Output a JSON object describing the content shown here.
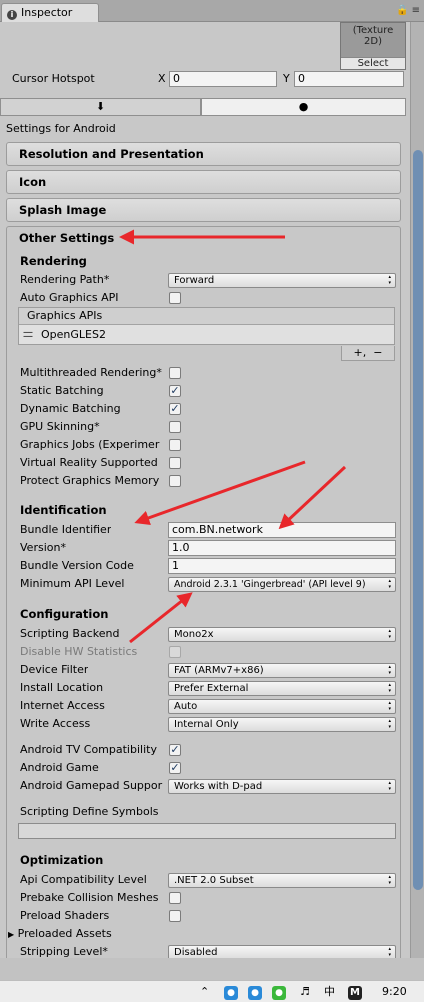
{
  "window": {
    "tab_title": "Inspector",
    "tab_icon": "info-icon"
  },
  "texture_preview": {
    "caption_line1": "(Texture",
    "caption_line2": "2D)",
    "select_label": "Select"
  },
  "cursor_hotspot": {
    "label": "Cursor Hotspot",
    "x_label": "X",
    "x_value": "0",
    "y_label": "Y",
    "y_value": "0"
  },
  "platform_tabs": [
    {
      "icon": "download-icon"
    },
    {
      "icon": "android-icon"
    }
  ],
  "settings_for": "Settings for Android",
  "sections": {
    "resolution": "Resolution and Presentation",
    "icon": "Icon",
    "splash": "Splash Image",
    "other": "Other Settings"
  },
  "rendering": {
    "heading": "Rendering",
    "rendering_path": {
      "label": "Rendering Path*",
      "value": "Forward"
    },
    "auto_graphics": {
      "label": "Auto Graphics API",
      "checked": false
    },
    "graphics_apis": {
      "header": "Graphics APIs",
      "items": [
        "OpenGLES2"
      ],
      "add": "+,",
      "remove": "−"
    },
    "multithreaded": {
      "label": "Multithreaded Rendering*",
      "checked": false
    },
    "static_batching": {
      "label": "Static Batching",
      "checked": true
    },
    "dynamic_batching": {
      "label": "Dynamic Batching",
      "checked": true
    },
    "gpu_skinning": {
      "label": "GPU Skinning*",
      "checked": false
    },
    "graphics_jobs": {
      "label": "Graphics Jobs (Experimer",
      "checked": false
    },
    "vr_supported": {
      "label": "Virtual Reality Supported",
      "checked": false
    },
    "protect_memory": {
      "label": "Protect Graphics Memory",
      "checked": false
    }
  },
  "identification": {
    "heading": "Identification",
    "bundle_id": {
      "label": "Bundle Identifier",
      "value": "com.BN.network"
    },
    "version": {
      "label": "Version*",
      "value": "1.0"
    },
    "bundle_code": {
      "label": "Bundle Version Code",
      "value": "1"
    },
    "min_api": {
      "label": "Minimum API Level",
      "value": "Android 2.3.1 'Gingerbread' (API level 9)"
    }
  },
  "configuration": {
    "heading": "Configuration",
    "scripting_backend": {
      "label": "Scripting Backend",
      "value": "Mono2x"
    },
    "disable_hw_stats": {
      "label": "Disable HW Statistics",
      "checked": false
    },
    "device_filter": {
      "label": "Device Filter",
      "value": "FAT (ARMv7+x86)"
    },
    "install_location": {
      "label": "Install Location",
      "value": "Prefer External"
    },
    "internet_access": {
      "label": "Internet Access",
      "value": "Auto"
    },
    "write_access": {
      "label": "Write Access",
      "value": "Internal Only"
    },
    "android_tv": {
      "label": "Android TV Compatibility",
      "checked": true
    },
    "android_game": {
      "label": "Android Game",
      "checked": true
    },
    "gamepad": {
      "label": "Android Gamepad Suppor",
      "value": "Works with D-pad"
    },
    "define_symbols": {
      "label": "Scripting Define Symbols",
      "value": ""
    }
  },
  "optimization": {
    "heading": "Optimization",
    "api_compat": {
      "label": "Api Compatibility Level",
      "value": ".NET 2.0 Subset"
    },
    "prebake": {
      "label": "Prebake Collision Meshes",
      "checked": false
    },
    "preload_shaders": {
      "label": "Preload Shaders",
      "checked": false
    },
    "preloaded_assets": {
      "label": "Preloaded Assets"
    },
    "stripping": {
      "label": "Stripping Level*",
      "value": "Disabled"
    }
  },
  "taskbar": {
    "time": "9:20",
    "ime": "中",
    "m_label": "M"
  },
  "colors": {
    "annotation_arrow": "#e8272b",
    "scroll_thumb": "#6f8fb3",
    "check": "#1f3b60"
  }
}
